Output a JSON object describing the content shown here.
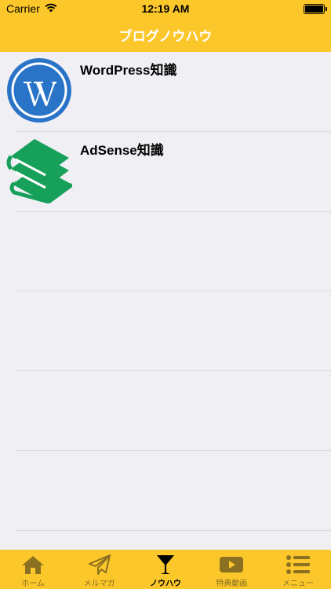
{
  "status_bar": {
    "carrier": "Carrier",
    "time": "12:19 AM"
  },
  "nav_bar": {
    "title": "ブログノウハウ"
  },
  "list": {
    "items": [
      {
        "label": "WordPress知識",
        "icon": "wordpress-logo-icon",
        "icon_color": "#2a74c8"
      },
      {
        "label": "AdSense知識",
        "icon": "books-icon",
        "icon_color": "#16a05a"
      }
    ]
  },
  "tab_bar": {
    "items": [
      {
        "label": "ホーム",
        "icon": "home-icon",
        "active": false
      },
      {
        "label": "メルマガ",
        "icon": "paper-plane-icon",
        "active": false
      },
      {
        "label": "ノウハウ",
        "icon": "cocktail-glass-icon",
        "active": true
      },
      {
        "label": "特典動画",
        "icon": "play-video-icon",
        "active": false
      },
      {
        "label": "メニュー",
        "icon": "list-menu-icon",
        "active": false
      }
    ]
  },
  "colors": {
    "accent": "#fcc72a",
    "inactive": "#8a7020",
    "active": "#000000",
    "list_bg": "#efeff4"
  }
}
